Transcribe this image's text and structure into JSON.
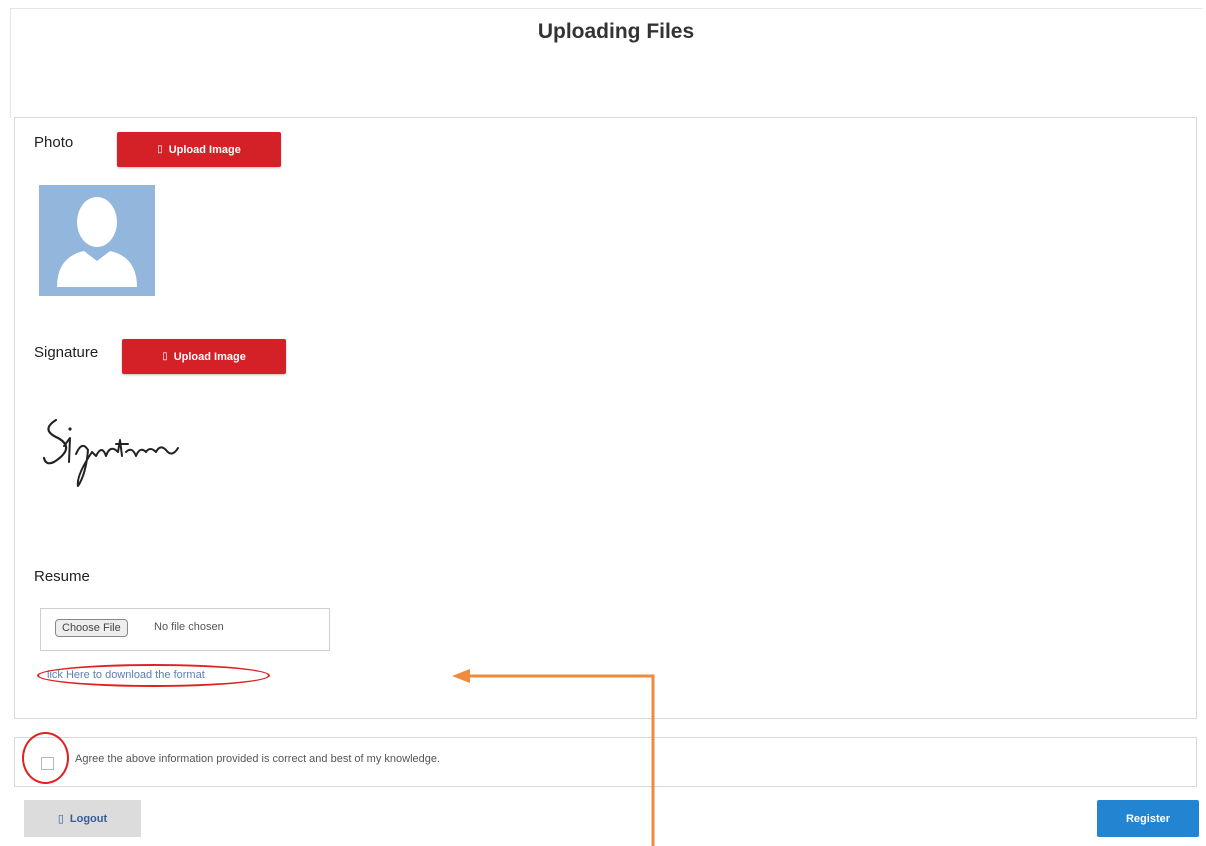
{
  "page": {
    "title": "Uploading Files"
  },
  "photo": {
    "label": "Photo",
    "upload_label": "Upload Image",
    "upload_icon": "upload-glyph"
  },
  "signature": {
    "label": "Signature",
    "upload_label": "Upload Image",
    "upload_icon": "upload-glyph",
    "image_text": "Signature"
  },
  "resume": {
    "label": "Resume",
    "choose_label": "Choose File",
    "status": "No file chosen",
    "download_link": "lick Here to download the format"
  },
  "agreement": {
    "text": "Agree the above information provided is correct and best of my knowledge."
  },
  "footer": {
    "logout_label": "Logout",
    "register_label": "Register"
  },
  "colors": {
    "upload_red": "#d42027",
    "register_blue": "#2384d2",
    "annotation_red": "#e02020",
    "annotation_orange": "#f08a3c"
  }
}
